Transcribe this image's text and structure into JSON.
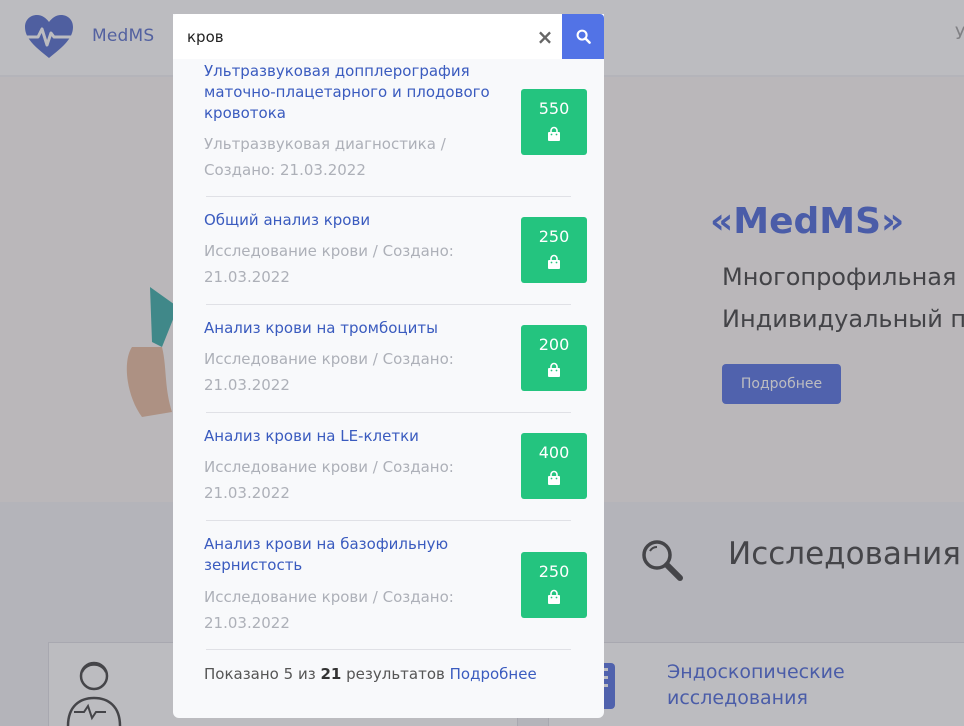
{
  "header": {
    "logo_text": "MedMS",
    "right_cut_text": "У"
  },
  "hero": {
    "title": "«MedMS»",
    "line1": "Многопрофильная",
    "line2": "Индивидуальный п",
    "button": "Подробнее"
  },
  "section": {
    "title": "Исследования"
  },
  "cards": [
    {
      "title": ""
    },
    {
      "title": "Эндоскопические\nисследования"
    }
  ],
  "search": {
    "query": "кров",
    "results": [
      {
        "title": "Ультразвуковая допплерография маточно-плацетарного и плодового кровотока",
        "meta": "Ультразвуковая диагностика / Создано: 21.03.2022",
        "price": "550"
      },
      {
        "title": "Общий анализ крови",
        "meta": "Исследование крови / Создано: 21.03.2022",
        "price": "250"
      },
      {
        "title": "Анализ крови на тромбоциты",
        "meta": "Исследование крови / Создано: 21.03.2022",
        "price": "200"
      },
      {
        "title": "Анализ крови на LE-клетки",
        "meta": "Исследование крови / Создано: 21.03.2022",
        "price": "400"
      },
      {
        "title": "Анализ крови на базофильную зернистость",
        "meta": "Исследование крови / Создано: 21.03.2022",
        "price": "250"
      }
    ],
    "footer": {
      "prefix": "Показано",
      "shown": "5",
      "middle": "из",
      "total": "21",
      "suffix": "результатов",
      "link": "Подробнее"
    }
  },
  "colors": {
    "brand_blue": "#4664df",
    "price_green": "#24c47f",
    "link_blue": "#3a5bbf"
  },
  "icons": [
    "heart-pulse-logo-icon",
    "close-icon",
    "search-icon",
    "shopping-bag-icon",
    "magnifier-icon",
    "doctor-icon",
    "endoscope-icon"
  ]
}
